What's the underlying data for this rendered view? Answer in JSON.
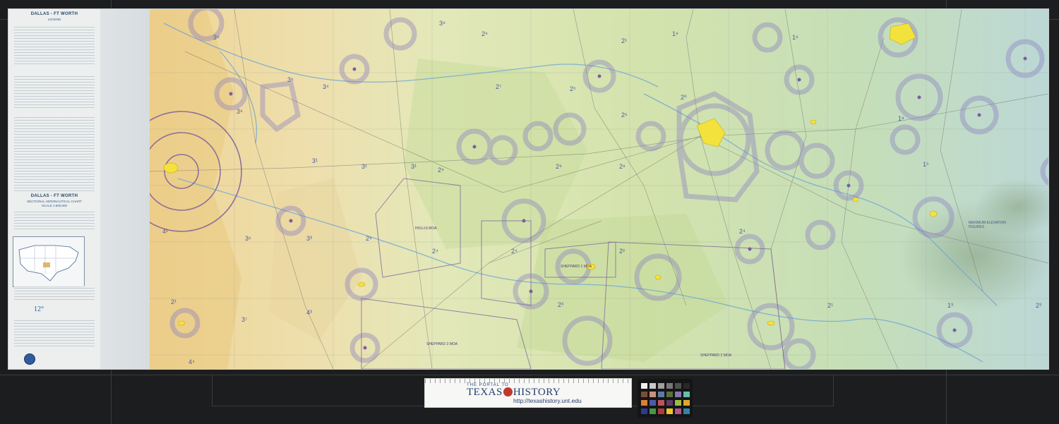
{
  "legend": {
    "title": "DALLAS - FT WORTH",
    "subtitle": "LEGEND",
    "chart_title": "DALLAS - FT WORTH",
    "chart_subtitle": "SECTIONAL AERONAUTICAL CHART",
    "chart_scale": "SCALE 1:500,000",
    "magnetic_variation": "12°"
  },
  "map": {
    "moa_labels": [
      "HOLLIS MOA",
      "SHEPPARD 2 MOA",
      "SHEPPARD 1 MOA",
      "SHEPPARD 3 MOA"
    ],
    "elevation_figures": [
      "3⁸",
      "3⁹",
      "3⁶",
      "3⁴",
      "3¹",
      "3¹",
      "3¹",
      "4²",
      "3⁶",
      "3³",
      "2⁸",
      "2⁹",
      "2⁹",
      "2⁸",
      "2⁷",
      "2⁵",
      "2⁶",
      "2⁴",
      "2⁴",
      "2⁰",
      "2¹",
      "2²",
      "2³",
      "2⁹",
      "2⁴",
      "1⁹",
      "1⁶",
      "1⁵",
      "1⁸",
      "1³",
      "2¹",
      "2³",
      "2¹",
      "4⁴",
      "4³",
      "3⁷",
      "3⁹"
    ],
    "terrain_note": "MAXIMUM ELEVATION FIGURES"
  },
  "colors": {
    "map_north": "#eef0cc",
    "map_mid": "#cddfa5",
    "map_east": "#bcd8cf",
    "map_west": "#efd596",
    "airspace": "#8a7fc0",
    "city": "#f4e23c",
    "roads": "#6b6b6b",
    "water": "#6fa6d3"
  },
  "ruler": {
    "line1": "THE PORTAL TO",
    "line2a": "TEXAS",
    "line2b": "HISTORY",
    "url": "http://texashistory.unt.edu"
  }
}
